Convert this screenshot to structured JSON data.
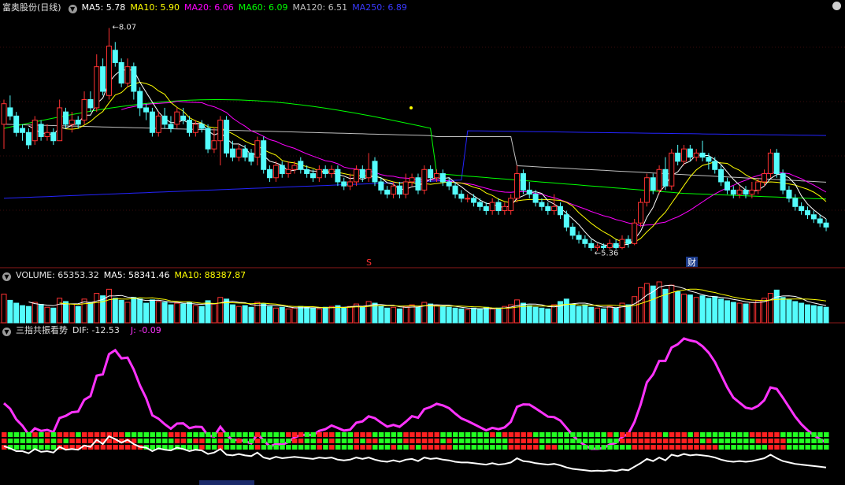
{
  "main_header": {
    "stock_title": "富奥股份(日线)",
    "ma5": "MA5: 5.78",
    "ma10": "MA10: 5.90",
    "ma20": "MA20: 6.06",
    "ma60": "MA60: 6.09",
    "ma120": "MA120: 6.51",
    "ma250": "MA250: 6.89"
  },
  "annotations": {
    "high_label": "8.07",
    "low_label": "5.36",
    "marker_s": "S",
    "marker_cai": "财"
  },
  "volume_header": {
    "volume": "VOLUME: 65353.32",
    "ma5": "MA5: 58341.46",
    "ma10": "MA10: 88387.87"
  },
  "indicator_header": {
    "name": "三指共振看势",
    "dif": "DIF: -12.53",
    "j": "J: -0.09"
  },
  "colors": {
    "up": "#ff3232",
    "down": "#54fcfc",
    "ma5": "#ffffff",
    "ma10": "#ffff00",
    "ma20": "#ff00ff",
    "ma60": "#00ff00",
    "ma120": "#c0c0c0",
    "ma250": "#2424ff",
    "dif": "#ff33ff",
    "baseline": "#ffffff",
    "grid_red": "#ff2020",
    "grid_green": "#22ff22",
    "separator": "#8b1a1a"
  },
  "chart_data": {
    "type": "candlestick",
    "price_axis": [
      5.3,
      8.2
    ],
    "candles": [
      [
        6.9,
        7.15,
        7.2,
        6.6
      ],
      [
        7.1,
        7.0,
        7.25,
        6.95
      ],
      [
        7.0,
        6.8,
        7.05,
        6.75
      ],
      [
        6.85,
        6.8,
        6.9,
        6.7
      ],
      [
        6.8,
        6.65,
        6.85,
        6.6
      ],
      [
        6.7,
        6.95,
        7.0,
        6.65
      ],
      [
        6.9,
        6.75,
        6.95,
        6.7
      ],
      [
        6.75,
        6.8,
        6.9,
        6.7
      ],
      [
        6.8,
        6.7,
        6.85,
        6.65
      ],
      [
        6.7,
        7.1,
        7.2,
        6.7
      ],
      [
        7.05,
        6.9,
        7.1,
        6.85
      ],
      [
        6.9,
        6.95,
        7.05,
        6.8
      ],
      [
        6.95,
        6.9,
        7.0,
        6.85
      ],
      [
        6.95,
        7.2,
        7.3,
        6.9
      ],
      [
        7.2,
        7.1,
        7.3,
        7.05
      ],
      [
        7.1,
        7.6,
        7.75,
        7.05
      ],
      [
        7.6,
        7.3,
        7.7,
        7.25
      ],
      [
        7.25,
        7.85,
        8.07,
        7.2
      ],
      [
        7.8,
        7.65,
        7.9,
        7.6
      ],
      [
        7.65,
        7.4,
        7.7,
        7.35
      ],
      [
        7.4,
        7.6,
        7.7,
        7.35
      ],
      [
        7.6,
        7.3,
        7.65,
        7.2
      ],
      [
        7.3,
        7.1,
        7.35,
        7.0
      ],
      [
        7.1,
        7.05,
        7.15,
        6.95
      ],
      [
        7.05,
        6.8,
        7.1,
        6.75
      ],
      [
        6.8,
        7.0,
        7.05,
        6.75
      ],
      [
        7.0,
        6.9,
        7.1,
        6.85
      ],
      [
        6.9,
        6.85,
        7.0,
        6.8
      ],
      [
        6.9,
        7.05,
        7.1,
        6.85
      ],
      [
        7.0,
        6.95,
        7.1,
        6.9
      ],
      [
        6.95,
        6.8,
        7.0,
        6.75
      ],
      [
        6.8,
        6.9,
        6.95,
        6.75
      ],
      [
        6.9,
        6.85,
        6.95,
        6.8
      ],
      [
        6.85,
        6.6,
        6.9,
        6.55
      ],
      [
        6.6,
        6.7,
        6.85,
        6.55
      ],
      [
        6.7,
        6.95,
        7.0,
        6.4
      ],
      [
        6.95,
        6.55,
        7.0,
        6.5
      ],
      [
        6.6,
        6.5,
        6.7,
        6.45
      ],
      [
        6.5,
        6.6,
        6.65,
        6.45
      ],
      [
        6.6,
        6.5,
        6.65,
        6.45
      ],
      [
        6.55,
        6.45,
        6.6,
        6.4
      ],
      [
        6.5,
        6.7,
        6.75,
        6.4
      ],
      [
        6.7,
        6.35,
        6.75,
        6.3
      ],
      [
        6.35,
        6.25,
        6.4,
        6.2
      ],
      [
        6.25,
        6.4,
        6.45,
        6.2
      ],
      [
        6.4,
        6.3,
        6.45,
        6.25
      ],
      [
        6.3,
        6.35,
        6.45,
        6.25
      ],
      [
        6.35,
        6.4,
        6.45,
        6.3
      ],
      [
        6.45,
        6.35,
        6.5,
        6.3
      ],
      [
        6.35,
        6.3,
        6.4,
        6.25
      ],
      [
        6.3,
        6.25,
        6.35,
        6.2
      ],
      [
        6.25,
        6.35,
        6.4,
        6.2
      ],
      [
        6.35,
        6.3,
        6.4,
        6.25
      ],
      [
        6.3,
        6.35,
        6.4,
        6.25
      ],
      [
        6.35,
        6.2,
        6.4,
        6.15
      ],
      [
        6.2,
        6.15,
        6.25,
        6.1
      ],
      [
        6.15,
        6.2,
        6.3,
        6.1
      ],
      [
        6.2,
        6.35,
        6.4,
        6.15
      ],
      [
        6.35,
        6.25,
        6.4,
        6.2
      ],
      [
        6.25,
        6.35,
        6.55,
        6.2
      ],
      [
        6.45,
        6.2,
        6.5,
        6.15
      ],
      [
        6.2,
        6.1,
        6.25,
        6.05
      ],
      [
        6.1,
        6.05,
        6.15,
        6.0
      ],
      [
        6.05,
        6.15,
        6.2,
        6.0
      ],
      [
        6.15,
        6.05,
        6.2,
        6.0
      ],
      [
        6.05,
        6.2,
        6.3,
        6.0
      ],
      [
        6.2,
        6.25,
        6.3,
        6.15
      ],
      [
        6.25,
        6.1,
        6.3,
        6.05
      ],
      [
        6.1,
        6.35,
        6.4,
        6.05
      ],
      [
        6.35,
        6.25,
        6.4,
        6.2
      ],
      [
        6.25,
        6.3,
        6.35,
        6.2
      ],
      [
        6.3,
        6.2,
        6.35,
        6.15
      ],
      [
        6.2,
        6.15,
        6.25,
        6.1
      ],
      [
        6.15,
        6.05,
        6.2,
        6.0
      ],
      [
        6.05,
        6.0,
        6.1,
        5.95
      ],
      [
        6.0,
        6.0,
        6.05,
        5.95
      ],
      [
        6.0,
        5.95,
        6.05,
        5.9
      ],
      [
        5.95,
        5.9,
        6.0,
        5.85
      ],
      [
        5.9,
        5.85,
        5.95,
        5.8
      ],
      [
        5.85,
        5.95,
        6.0,
        5.8
      ],
      [
        5.95,
        5.85,
        6.0,
        5.8
      ],
      [
        5.85,
        5.9,
        5.95,
        5.8
      ],
      [
        5.85,
        6.0,
        6.05,
        5.8
      ],
      [
        6.0,
        6.3,
        6.4,
        5.95
      ],
      [
        6.3,
        6.1,
        6.35,
        6.05
      ],
      [
        6.1,
        6.05,
        6.2,
        6.0
      ],
      [
        6.05,
        5.95,
        6.1,
        5.9
      ],
      [
        5.95,
        5.9,
        6.0,
        5.85
      ],
      [
        5.9,
        5.85,
        5.95,
        5.8
      ],
      [
        5.85,
        5.9,
        6.05,
        5.8
      ],
      [
        5.9,
        5.8,
        5.95,
        5.75
      ],
      [
        5.8,
        5.65,
        5.85,
        5.6
      ],
      [
        5.65,
        5.55,
        5.7,
        5.5
      ],
      [
        5.55,
        5.5,
        5.6,
        5.45
      ],
      [
        5.5,
        5.45,
        5.55,
        5.4
      ],
      [
        5.45,
        5.4,
        5.5,
        5.36
      ],
      [
        5.4,
        5.42,
        5.45,
        5.36
      ],
      [
        5.42,
        5.4,
        5.45,
        5.38
      ],
      [
        5.4,
        5.45,
        5.5,
        5.38
      ],
      [
        5.45,
        5.4,
        5.5,
        5.38
      ],
      [
        5.4,
        5.5,
        5.55,
        5.38
      ],
      [
        5.5,
        5.45,
        5.55,
        5.4
      ],
      [
        5.45,
        5.7,
        5.75,
        5.43
      ],
      [
        5.7,
        5.95,
        6.0,
        5.65
      ],
      [
        5.95,
        6.25,
        6.3,
        5.9
      ],
      [
        6.25,
        6.1,
        6.3,
        6.05
      ],
      [
        6.1,
        6.35,
        6.4,
        6.05
      ],
      [
        6.35,
        6.15,
        6.5,
        6.1
      ],
      [
        6.15,
        6.55,
        6.6,
        6.1
      ],
      [
        6.55,
        6.45,
        6.65,
        6.4
      ],
      [
        6.45,
        6.6,
        6.65,
        6.4
      ],
      [
        6.6,
        6.5,
        6.65,
        6.45
      ],
      [
        6.5,
        6.55,
        6.6,
        6.45
      ],
      [
        6.55,
        6.5,
        6.7,
        6.45
      ],
      [
        6.5,
        6.45,
        6.55,
        6.35
      ],
      [
        6.45,
        6.35,
        6.5,
        6.3
      ],
      [
        6.35,
        6.2,
        6.4,
        6.15
      ],
      [
        6.2,
        6.1,
        6.25,
        6.05
      ],
      [
        6.1,
        6.05,
        6.15,
        6.0
      ],
      [
        6.05,
        6.1,
        6.15,
        6.0
      ],
      [
        6.1,
        6.05,
        6.15,
        6.0
      ],
      [
        6.05,
        6.1,
        6.2,
        6.0
      ],
      [
        6.1,
        6.2,
        6.25,
        6.05
      ],
      [
        6.2,
        6.3,
        6.35,
        6.15
      ],
      [
        6.3,
        6.55,
        6.6,
        6.25
      ],
      [
        6.55,
        6.3,
        6.6,
        6.25
      ],
      [
        6.3,
        6.1,
        6.35,
        6.05
      ],
      [
        6.1,
        6.0,
        6.15,
        5.95
      ],
      [
        6.0,
        5.9,
        6.05,
        5.85
      ],
      [
        5.9,
        5.85,
        5.95,
        5.8
      ],
      [
        5.85,
        5.8,
        5.9,
        5.75
      ],
      [
        5.8,
        5.75,
        5.85,
        5.7
      ],
      [
        5.75,
        5.7,
        5.8,
        5.65
      ],
      [
        5.7,
        5.65,
        5.75,
        5.6
      ]
    ],
    "volume": [
      70,
      55,
      48,
      42,
      40,
      50,
      45,
      38,
      36,
      60,
      52,
      46,
      40,
      58,
      50,
      72,
      66,
      82,
      60,
      55,
      50,
      62,
      58,
      48,
      56,
      52,
      50,
      44,
      48,
      46,
      50,
      42,
      40,
      54,
      46,
      62,
      58,
      44,
      40,
      42,
      38,
      50,
      46,
      40,
      36,
      38,
      34,
      36,
      40,
      38,
      36,
      34,
      38,
      40,
      42,
      36,
      40,
      46,
      38,
      52,
      48,
      40,
      36,
      38,
      34,
      40,
      44,
      38,
      50,
      46,
      42,
      40,
      38,
      36,
      34,
      32,
      36,
      34,
      38,
      34,
      36,
      40,
      44,
      56,
      48,
      42,
      38,
      36,
      34,
      44,
      52,
      58,
      46,
      40,
      44,
      38,
      36,
      34,
      40,
      36,
      48,
      44,
      64,
      86,
      96,
      90,
      100,
      82,
      92,
      76,
      70,
      68,
      62,
      66,
      60,
      64,
      58,
      54,
      50,
      48,
      46,
      50,
      54,
      60,
      72,
      80,
      62,
      56,
      52,
      48,
      44,
      42,
      40,
      38
    ]
  }
}
